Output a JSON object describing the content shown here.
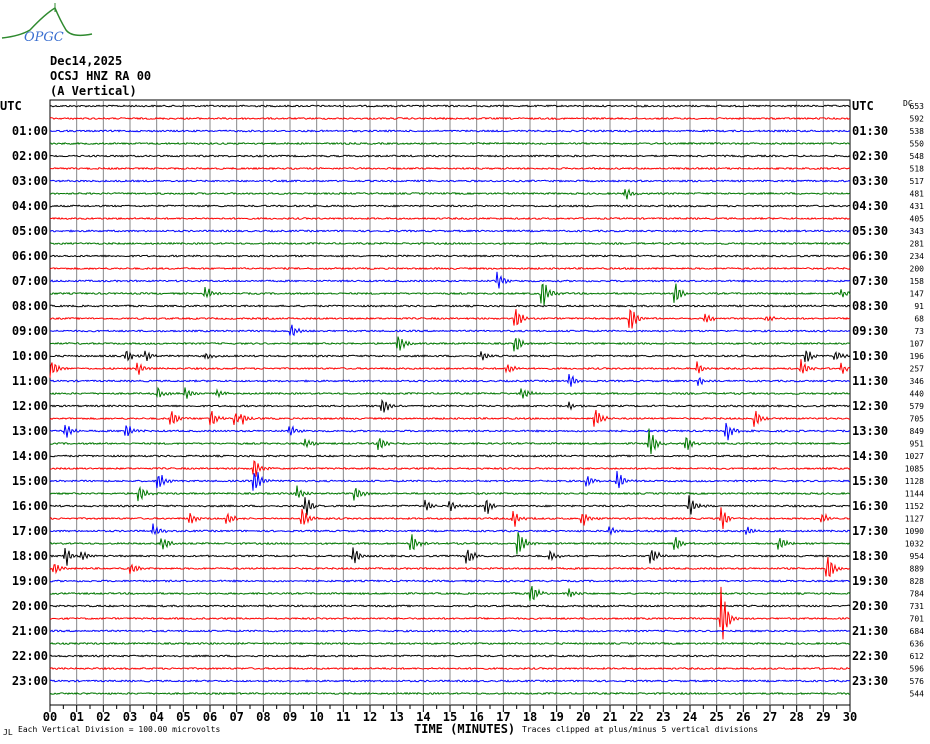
{
  "header": {
    "logo_text": "OPGC",
    "date": "Dec14,2025",
    "station": "OCSJ HNZ RA 00",
    "component": "(A Vertical)",
    "left_tz": "UTC",
    "right_tz": "UTC",
    "right_col_header": "DC"
  },
  "footer": {
    "corner_mark": "JL",
    "scale_note": "Each Vertical Division =  100.00 microvolts",
    "xlabel": "TIME (MINUTES)",
    "clip_note": "Traces clipped at plus/minus 5 vertical divisions"
  },
  "colors": {
    "trace_cycle": [
      "#000000",
      "#ff0000",
      "#0000ff",
      "#007700"
    ],
    "grid": "#888888"
  },
  "chart_data": {
    "type": "line",
    "title": "OCSJ HNZ RA 00 (A Vertical) Dec14,2025",
    "xlabel": "TIME (MINUTES)",
    "xlim": [
      0,
      30
    ],
    "x_ticks": [
      "00",
      "01",
      "02",
      "03",
      "04",
      "05",
      "06",
      "07",
      "08",
      "09",
      "10",
      "11",
      "12",
      "13",
      "14",
      "15",
      "16",
      "17",
      "18",
      "19",
      "20",
      "21",
      "22",
      "23",
      "24",
      "25",
      "26",
      "27",
      "28",
      "29",
      "30"
    ],
    "rows_per_hour": 2,
    "left_labels": [
      "UTC",
      "01:00",
      "02:00",
      "03:00",
      "04:00",
      "05:00",
      "06:00",
      "07:00",
      "08:00",
      "09:00",
      "10:00",
      "11:00",
      "12:00",
      "13:00",
      "14:00",
      "15:00",
      "16:00",
      "17:00",
      "18:00",
      "19:00",
      "20:00",
      "21:00",
      "22:00",
      "23:00"
    ],
    "right_labels": [
      "UTC",
      "01:30",
      "02:30",
      "03:30",
      "04:30",
      "05:30",
      "06:30",
      "07:30",
      "08:30",
      "09:30",
      "10:30",
      "11:30",
      "12:30",
      "13:30",
      "14:30",
      "15:30",
      "16:30",
      "17:30",
      "18:30",
      "19:30",
      "20:30",
      "21:30",
      "22:30",
      "23:30"
    ],
    "dc_offsets": [
      653,
      592,
      538,
      550,
      548,
      518,
      517,
      481,
      431,
      405,
      343,
      281,
      234,
      200,
      158,
      147,
      91,
      68,
      73,
      107,
      196,
      257,
      346,
      440,
      579,
      705,
      849,
      951,
      1027,
      1085,
      1128,
      1144,
      1152,
      1127,
      1090,
      1032,
      954,
      889,
      828,
      784,
      731,
      701,
      684,
      636,
      612,
      596,
      576,
      544
    ],
    "events": [
      [
        7,
        21.6,
        6
      ],
      [
        14,
        16.8,
        8
      ],
      [
        15,
        5.85,
        6
      ],
      [
        15,
        18.5,
        14
      ],
      [
        15,
        23.5,
        9
      ],
      [
        15,
        29.7,
        4
      ],
      [
        17,
        17.5,
        9
      ],
      [
        17,
        21.8,
        10
      ],
      [
        17,
        24.6,
        5
      ],
      [
        17,
        26.9,
        3
      ],
      [
        18,
        9.1,
        6
      ],
      [
        19,
        13.1,
        8
      ],
      [
        19,
        17.5,
        8
      ],
      [
        20,
        2.9,
        6
      ],
      [
        20,
        3.6,
        5
      ],
      [
        20,
        5.9,
        4
      ],
      [
        20,
        16.2,
        4
      ],
      [
        20,
        28.4,
        7
      ],
      [
        20,
        29.5,
        5
      ],
      [
        21,
        0.1,
        8
      ],
      [
        21,
        3.3,
        7
      ],
      [
        21,
        17.2,
        4
      ],
      [
        21,
        24.3,
        6
      ],
      [
        21,
        28.2,
        7
      ],
      [
        21,
        29.7,
        5
      ],
      [
        22,
        19.5,
        8
      ],
      [
        22,
        24.4,
        4
      ],
      [
        23,
        4.1,
        5
      ],
      [
        23,
        5.1,
        5
      ],
      [
        23,
        6.3,
        4
      ],
      [
        23,
        17.7,
        7
      ],
      [
        24,
        12.5,
        9
      ],
      [
        24,
        19.5,
        3
      ],
      [
        25,
        4.6,
        7
      ],
      [
        25,
        6.1,
        8
      ],
      [
        25,
        7.0,
        7
      ],
      [
        25,
        7.2,
        7
      ],
      [
        25,
        20.5,
        8
      ],
      [
        25,
        26.5,
        7
      ],
      [
        26,
        0.6,
        7
      ],
      [
        26,
        2.9,
        7
      ],
      [
        26,
        9.0,
        6
      ],
      [
        26,
        25.4,
        9
      ],
      [
        27,
        9.6,
        5
      ],
      [
        27,
        12.4,
        6
      ],
      [
        27,
        22.5,
        14
      ],
      [
        27,
        23.9,
        8
      ],
      [
        29,
        7.7,
        10
      ],
      [
        30,
        4.1,
        8
      ],
      [
        30,
        7.7,
        12
      ],
      [
        30,
        20.2,
        5
      ],
      [
        30,
        21.3,
        10
      ],
      [
        31,
        3.4,
        8
      ],
      [
        31,
        9.3,
        7
      ],
      [
        31,
        11.5,
        6
      ],
      [
        32,
        9.6,
        10
      ],
      [
        32,
        14.1,
        5
      ],
      [
        32,
        15.0,
        5
      ],
      [
        32,
        16.4,
        7
      ],
      [
        32,
        24.0,
        9
      ],
      [
        33,
        5.3,
        5
      ],
      [
        33,
        6.7,
        5
      ],
      [
        33,
        9.5,
        9
      ],
      [
        33,
        17.4,
        8
      ],
      [
        33,
        20.0,
        7
      ],
      [
        33,
        25.2,
        10
      ],
      [
        33,
        29.0,
        4
      ],
      [
        34,
        3.9,
        6
      ],
      [
        34,
        21.0,
        4
      ],
      [
        34,
        26.2,
        4
      ],
      [
        35,
        4.2,
        8
      ],
      [
        35,
        13.6,
        8
      ],
      [
        35,
        17.6,
        12
      ],
      [
        35,
        23.5,
        6
      ],
      [
        35,
        27.4,
        6
      ],
      [
        36,
        0.6,
        9
      ],
      [
        36,
        1.2,
        5
      ],
      [
        36,
        11.4,
        9
      ],
      [
        36,
        15.7,
        7
      ],
      [
        36,
        18.8,
        5
      ],
      [
        36,
        22.6,
        8
      ],
      [
        37,
        0.2,
        6
      ],
      [
        37,
        3.1,
        4
      ],
      [
        37,
        29.2,
        12
      ],
      [
        39,
        18.1,
        8
      ],
      [
        39,
        19.5,
        4
      ],
      [
        41,
        25.2,
        28
      ]
    ]
  }
}
